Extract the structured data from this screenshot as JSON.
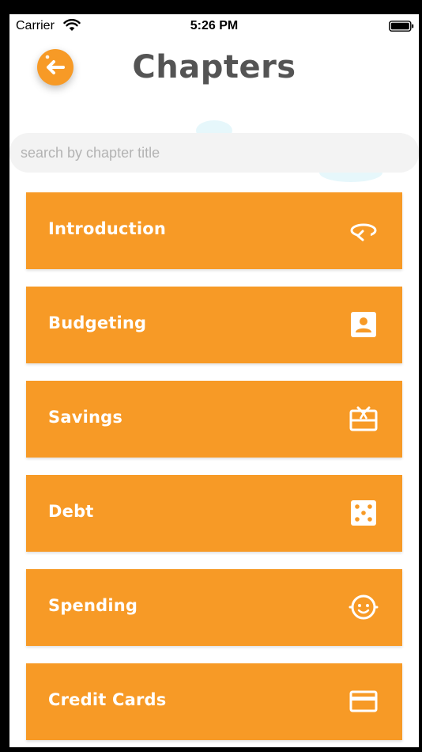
{
  "status": {
    "carrier": "Carrier",
    "time": "5:26 PM"
  },
  "header": {
    "title": "Chapters",
    "back_icon": "arrow-left-icon"
  },
  "search": {
    "placeholder": "search by chapter title",
    "value": ""
  },
  "colors": {
    "accent": "#F79A26",
    "title": "#545454",
    "search_bg": "#f3f3f3"
  },
  "chapters": [
    {
      "label": "Introduction",
      "icon": "rotate-icon"
    },
    {
      "label": "Budgeting",
      "icon": "contact-card-icon"
    },
    {
      "label": "Savings",
      "icon": "gift-card-icon"
    },
    {
      "label": "Debt",
      "icon": "dice-icon"
    },
    {
      "label": "Spending",
      "icon": "child-face-icon"
    },
    {
      "label": "Credit Cards",
      "icon": "credit-card-icon"
    }
  ]
}
